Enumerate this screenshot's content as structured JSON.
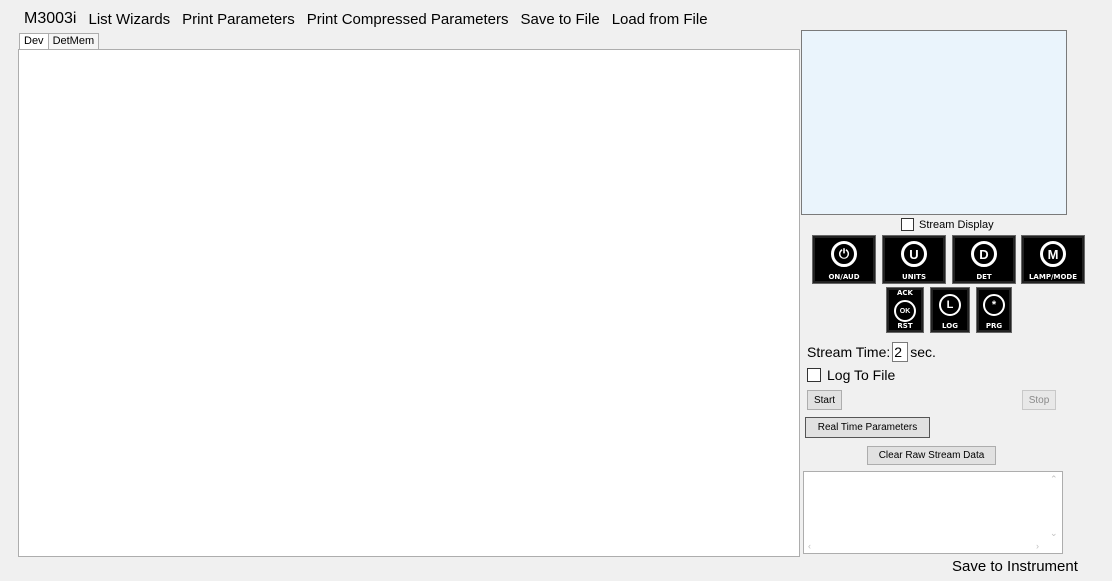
{
  "menubar": {
    "app_label": "M3003i",
    "items": [
      "List Wizards",
      "Print Parameters",
      "Print Compressed Parameters",
      "Save to File",
      "Load from File"
    ]
  },
  "tabs": [
    "Dev",
    "DetMem"
  ],
  "stream_display": {
    "label": "Stream Display",
    "checked": false
  },
  "keypad": {
    "row1": [
      {
        "icon": "power-speaker-icon",
        "glyph": "⏻",
        "label": "ON/AUD"
      },
      {
        "icon": "units-icon",
        "glyph": "U",
        "label": "UNITS"
      },
      {
        "icon": "det-icon",
        "glyph": "D",
        "label": "DET"
      },
      {
        "icon": "lamp-mode-icon",
        "glyph": "M",
        "label": "LAMP/MODE"
      }
    ],
    "row2": [
      {
        "icon": "ack-rst-icon",
        "glyph": "OK",
        "top_label": "ACK",
        "label": "RST"
      },
      {
        "icon": "log-icon",
        "glyph": "L",
        "label": "LOG"
      },
      {
        "icon": "prg-icon",
        "glyph": "*",
        "label": "PRG"
      }
    ]
  },
  "stream_time": {
    "label": "Stream Time:",
    "value": "2",
    "unit": "sec."
  },
  "log_to_file": {
    "label": "Log To File",
    "checked": false
  },
  "buttons": {
    "start": "Start",
    "stop": "Stop",
    "real_time_parameters": "Real Time Parameters",
    "clear_raw_stream_data": "Clear Raw Stream Data",
    "save_to_instrument": "Save to Instrument"
  },
  "scroll_glyphs": {
    "up": "⌃",
    "down": "⌄",
    "left": "‹",
    "right": "›"
  }
}
